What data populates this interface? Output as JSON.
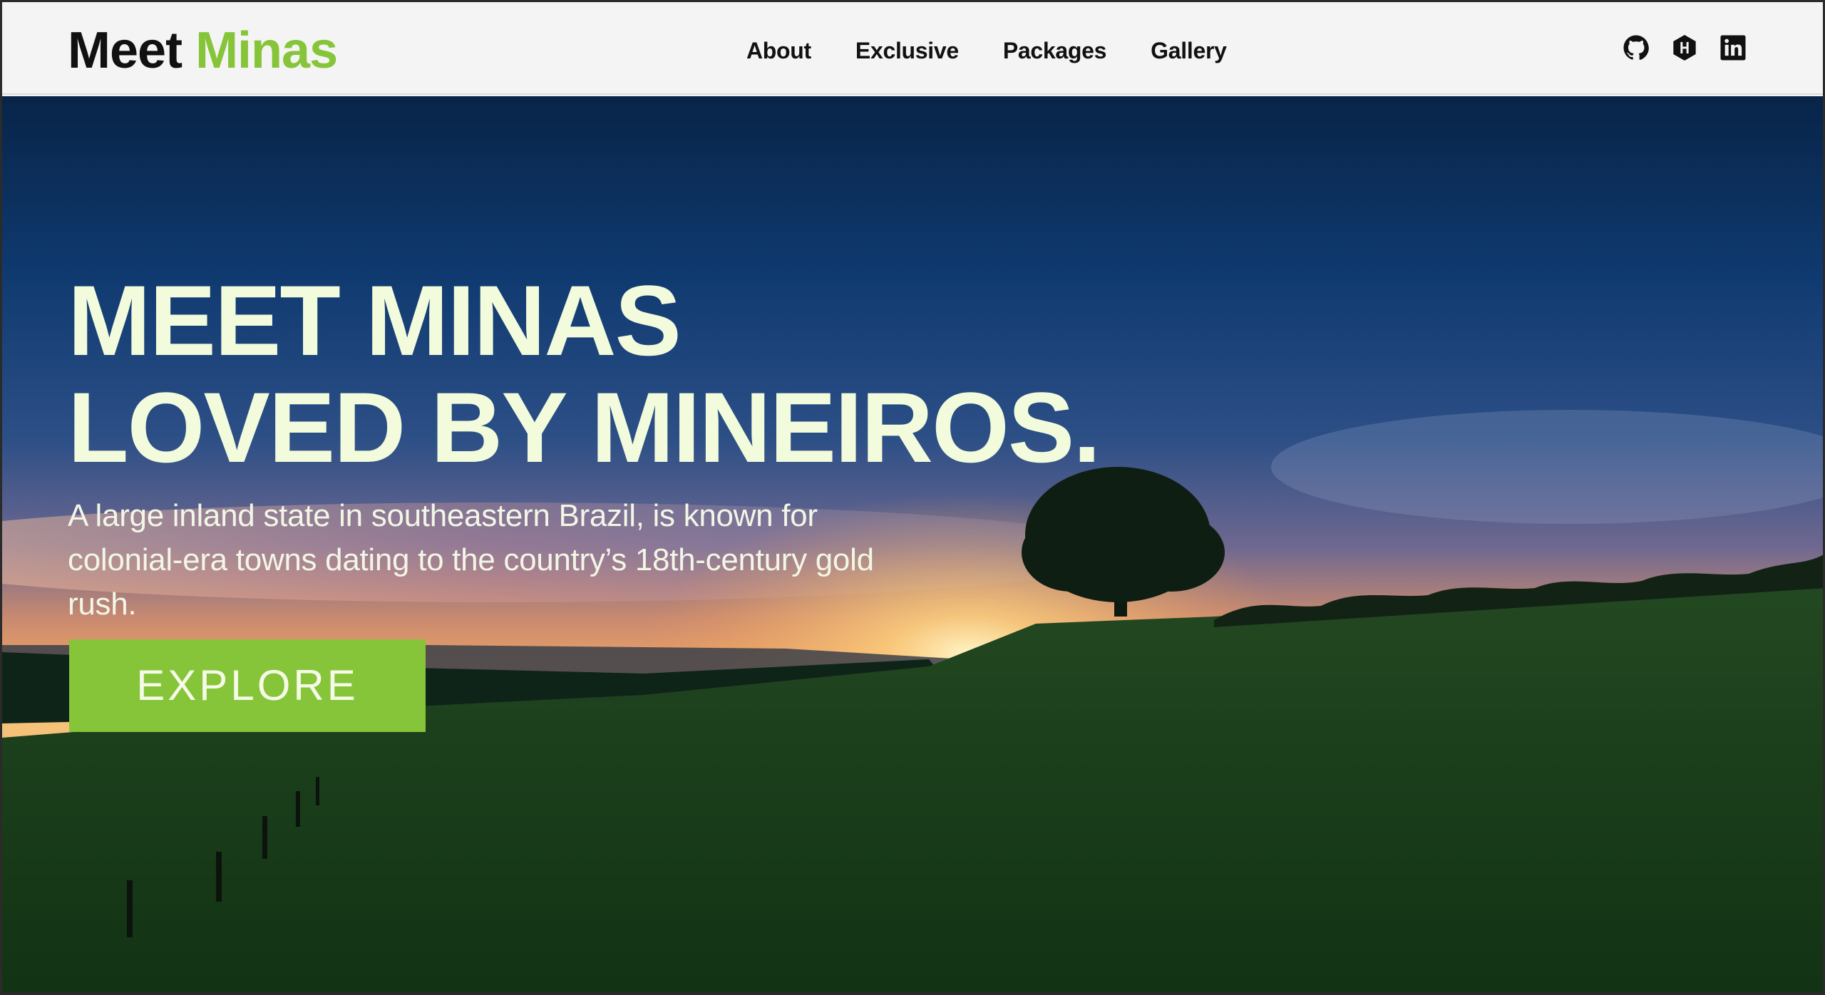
{
  "brand": {
    "word1": "Meet",
    "word2": "Minas",
    "accent": "#86c53a"
  },
  "nav": {
    "items": [
      "About",
      "Exclusive",
      "Packages",
      "Gallery"
    ]
  },
  "social": [
    "github-icon",
    "hashnode-icon",
    "linkedin-icon"
  ],
  "hero": {
    "headline_line1": "MEET MINAS",
    "headline_line2": "LOVED BY MINEIROS.",
    "subtitle": "A large inland state in southeastern Brazil, is known for colonial-era towns dating to the country’s 18th-century gold rush.",
    "cta_label": "EXPLORE"
  },
  "colors": {
    "headline": "#f2fbdc",
    "cta_bg": "#86c53a",
    "header_bg": "#f4f4f4"
  }
}
